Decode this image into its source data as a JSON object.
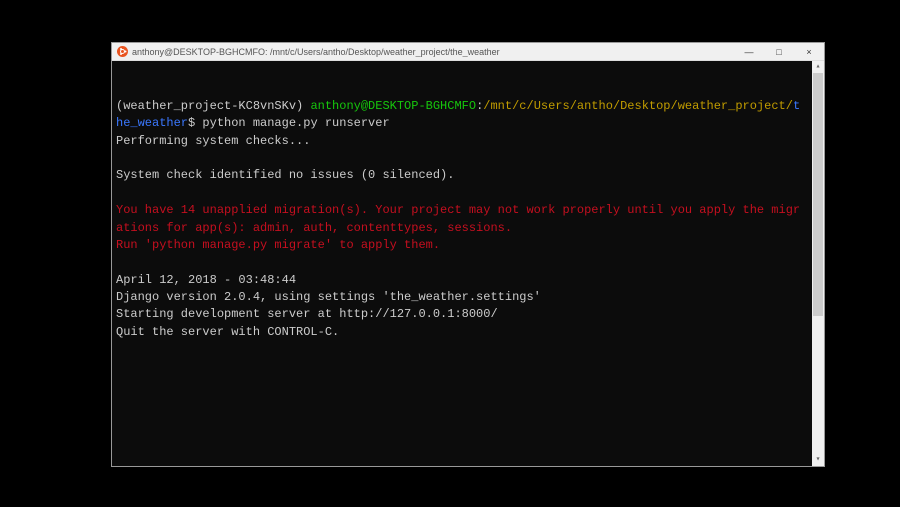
{
  "titlebar": {
    "title": "anthony@DESKTOP-BGHCMFO: /mnt/c/Users/antho/Desktop/weather_project/the_weather",
    "min_label": "—",
    "max_label": "□",
    "close_label": "×"
  },
  "terminal": {
    "venv": "(weather_project-KC8vnSKv) ",
    "user_host": "anthony@DESKTOP-BGHCMFO",
    "colon": ":",
    "cwd": "/mnt/c/Users/antho/Desktop/weather_project/the_weather",
    "prompt_symbol": "$ ",
    "command": "python manage.py runserver",
    "lines_checks": "Performing system checks...",
    "blank": "",
    "lines_noissues": "System check identified no issues (0 silenced).",
    "migrations_l1": "You have 14 unapplied migration(s). Your project may not work properly until you apply the migrations for app(s): admin, auth, contenttypes, sessions.",
    "migrations_l2": "Run 'python manage.py migrate' to apply them.",
    "timestamp": "April 12, 2018 - 03:48:44",
    "django_version": "Django version 2.0.4, using settings 'the_weather.settings'",
    "server_start": "Starting development server at http://127.0.0.1:8000/",
    "quit": "Quit the server with CONTROL-C."
  },
  "colors": {
    "venv": "#cccccc",
    "user_host": "#16c60c",
    "cwd": "#c19c00",
    "cwd_wrap": "#3b78ff",
    "warning": "#c50f1f",
    "text": "#cccccc"
  }
}
